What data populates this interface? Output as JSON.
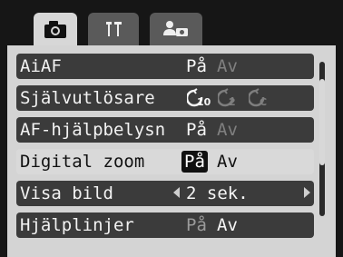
{
  "tabs": [
    {
      "icon": "camera-icon",
      "active": true
    },
    {
      "icon": "wrench-hammer-icon",
      "active": false
    },
    {
      "icon": "person-camera-icon",
      "active": false
    }
  ],
  "menu": {
    "rows": [
      {
        "label": "AiAF",
        "options": [
          "På",
          "Av"
        ],
        "current": "På"
      },
      {
        "label": "Självutlösare",
        "options": [
          "10-second-timer-icon",
          "2-second-timer-icon",
          "custom-timer-icon"
        ],
        "current": "10-second-timer-icon",
        "timer_labels": [
          "10",
          "2",
          "C"
        ]
      },
      {
        "label": "AF-hjälpbelysn",
        "options": [
          "På",
          "Av"
        ],
        "current": "På"
      },
      {
        "label": "Digital zoom",
        "options": [
          "På",
          "Av"
        ],
        "current": "På",
        "selected": true
      },
      {
        "label": "Visa bild",
        "value": "2 sek."
      },
      {
        "label": "Hjälplinjer",
        "options": [
          "På",
          "Av"
        ],
        "current": "Av"
      }
    ]
  },
  "scrollbar": {
    "position": 0.25
  },
  "colors": {
    "background": "#161616",
    "row": "#3b3b3b",
    "selected_row": "#d9d9d9",
    "active_tab": "#d7d7d7",
    "inactive_tab": "#5a5a5a"
  }
}
